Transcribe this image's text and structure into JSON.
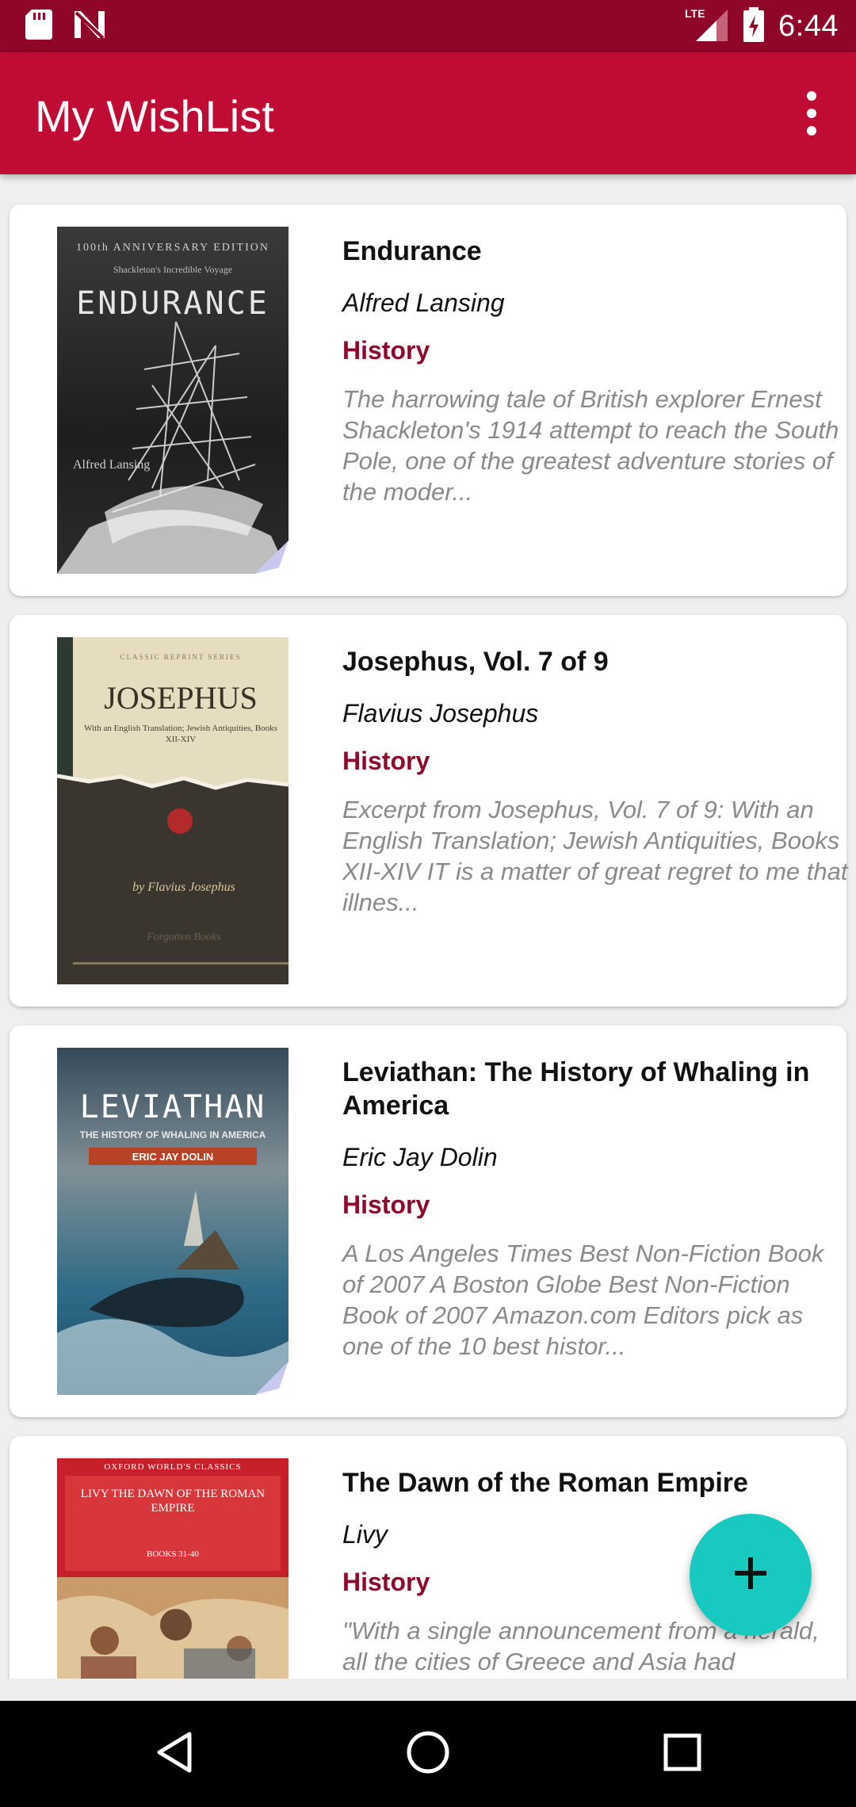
{
  "status_bar": {
    "time": "6:44",
    "network": "LTE",
    "icons": [
      "sd-card-icon",
      "no-signal-n-icon",
      "lte-signal-icon",
      "battery-charging-icon"
    ]
  },
  "app_bar": {
    "title": "My WishList",
    "overflow_icon": "more-vert-icon"
  },
  "books": [
    {
      "title": "Endurance",
      "author": "Alfred Lansing",
      "genre": "History",
      "description": "The harrowing tale of British explorer Ernest Shackleton's 1914 attempt to reach the South Pole, one of the greatest adventure stories of the moder...",
      "cover": {
        "top_line": "100th ANNIVERSARY EDITION",
        "subtitle": "Shackleton's Incredible Voyage",
        "title": "ENDURANCE",
        "author": "Alfred Lansing",
        "colors": {
          "bg": "#2a2a2a",
          "text": "#e8e8e8"
        }
      }
    },
    {
      "title": "Josephus, Vol. 7 of 9",
      "author": "Flavius Josephus",
      "genre": "History",
      "description": "Excerpt from Josephus, Vol. 7 of 9: With an English Translation; Jewish Antiquities, Books XII-XIV IT is a matter of great regret to me that illnes...",
      "cover": {
        "top_line": "CLASSIC REPRINT SERIES",
        "title": "JOSEPHUS",
        "subtitle": "With an English Translation; Jewish Antiquities, Books XII-XIV",
        "author": "by Flavius Josephus",
        "publisher": "Forgotten Books",
        "colors": {
          "bg": "#e6dcc0",
          "text": "#3a3026"
        }
      }
    },
    {
      "title": "Leviathan: The History of Whaling in America",
      "author": "Eric Jay Dolin",
      "genre": "History",
      "description": "A Los Angeles Times Best Non-Fiction Book of 2007 A Boston Globe Best Non-Fiction Book of 2007 Amazon.com Editors pick as one of the 10 best histor...",
      "cover": {
        "title": "LEVIATHAN",
        "subtitle": "THE HISTORY OF WHALING IN AMERICA",
        "author": "ERIC JAY DOLIN",
        "colors": {
          "bg": "#3d5666",
          "text": "#ffffff"
        }
      }
    },
    {
      "title": "The Dawn of the Roman Empire",
      "author": "Livy",
      "genre": "History",
      "description": "\"With a single announcement from a herald, all the cities of Greece and Asia had",
      "cover": {
        "top_line": "OXFORD WORLD'S CLASSICS",
        "title": "LIVY THE DAWN OF THE ROMAN EMPIRE",
        "subtitle": "BOOKS 31-40",
        "colors": {
          "bg": "#c8202a",
          "text": "#ffffff"
        }
      }
    }
  ],
  "fab": {
    "icon": "add-icon"
  },
  "nav_bar": {
    "icons": [
      "back-triangle-icon",
      "home-circle-icon",
      "recents-square-icon"
    ]
  },
  "colors": {
    "status_bar": "#8f0628",
    "app_bar": "#c00b34",
    "genre_text": "#8c0a2b",
    "fab": "#17c9bf"
  }
}
